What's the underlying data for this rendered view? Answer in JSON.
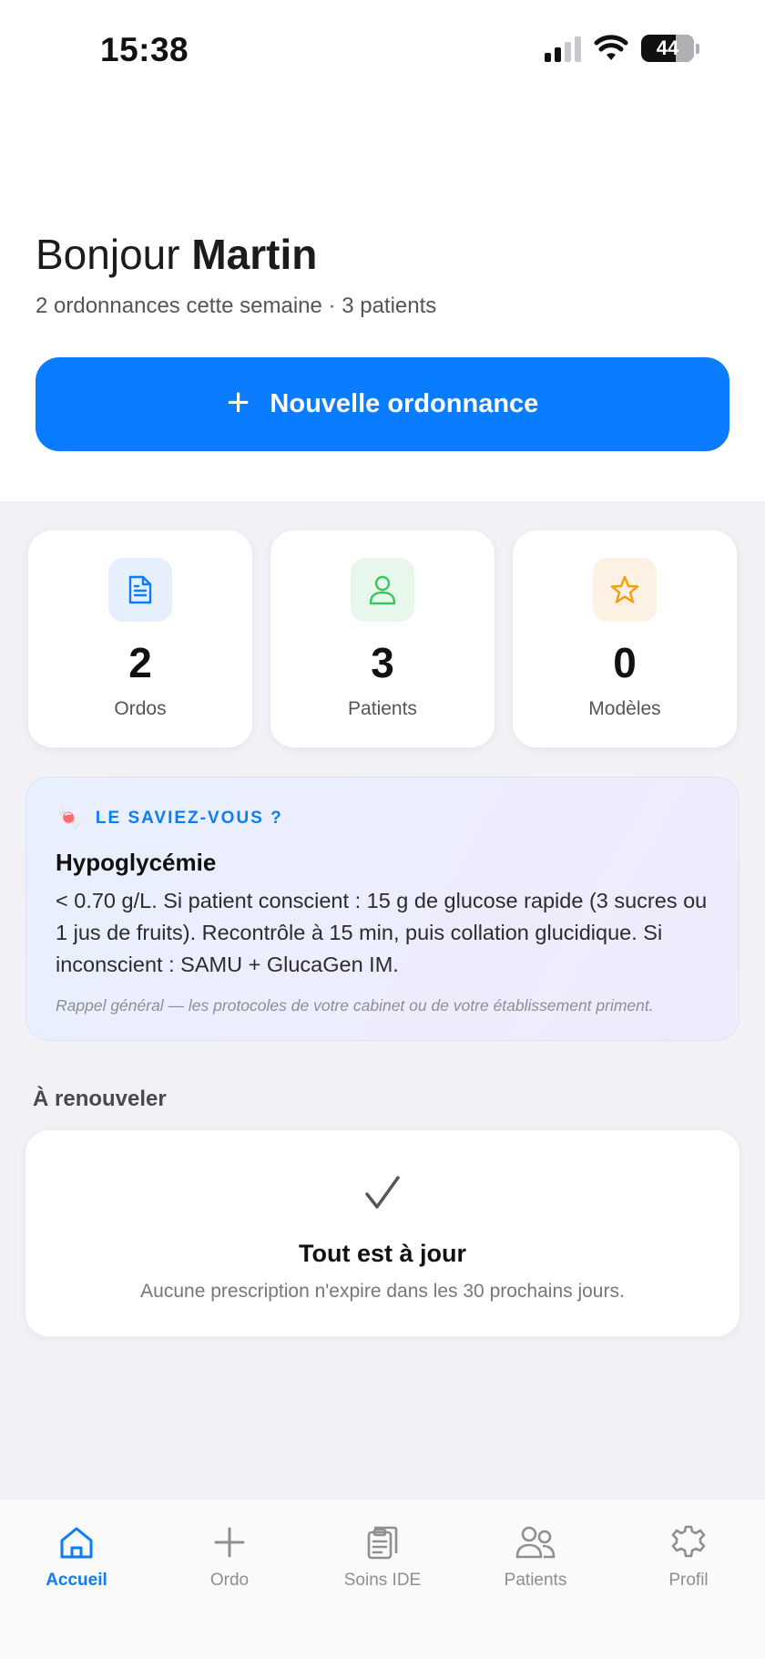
{
  "status_bar": {
    "time": "15:38",
    "battery": "44"
  },
  "header": {
    "greeting_prefix": "Bonjour",
    "user_name": "Martin",
    "subtitle": "2 ordonnances cette semaine · 3 patients",
    "new_button_label": "Nouvelle ordonnance"
  },
  "stats": [
    {
      "value": "2",
      "label": "Ordos",
      "icon": "document-icon",
      "icon_color": "#0a7cff",
      "bg_color": "#e6f0fd"
    },
    {
      "value": "3",
      "label": "Patients",
      "icon": "person-icon",
      "icon_color": "#34c759",
      "bg_color": "#e8f7ec"
    },
    {
      "value": "0",
      "label": "Modèles",
      "icon": "star-icon",
      "icon_color": "#f59e0b",
      "bg_color": "#fdf1e3"
    }
  ],
  "tip": {
    "emoji": "🍬",
    "kicker": "LE SAVIEZ-VOUS ?",
    "title": "Hypoglycémie",
    "body": "< 0.70 g/L. Si patient conscient : 15 g de glucose rapide (3 sucres ou 1 jus de fruits). Recontrôle à 15 min, puis collation glucidique. Si inconscient : SAMU + GlucaGen IM.",
    "note": "Rappel général — les protocoles de votre cabinet ou de votre établissement priment."
  },
  "renew": {
    "section_title": "À renouveler",
    "title": "Tout est à jour",
    "subtitle": "Aucune prescription n'expire dans les 30 prochains jours."
  },
  "tabs": [
    {
      "label": "Accueil",
      "icon": "home-icon",
      "active": true
    },
    {
      "label": "Ordo",
      "icon": "plus-icon",
      "active": false
    },
    {
      "label": "Soins IDE",
      "icon": "clipboard-icon",
      "active": false
    },
    {
      "label": "Patients",
      "icon": "people-icon",
      "active": false
    },
    {
      "label": "Profil",
      "icon": "gear-icon",
      "active": false
    }
  ],
  "colors": {
    "accent": "#0a7cff",
    "background": "#f1f1f6"
  }
}
